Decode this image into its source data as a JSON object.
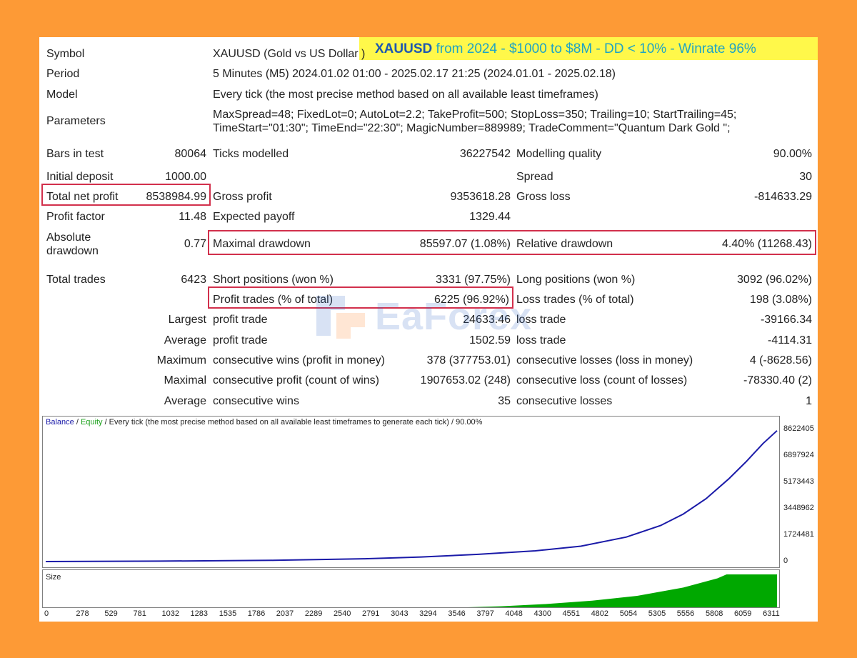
{
  "banner": {
    "symbol": "XAUUSD",
    "rest": " from 2024 - $1000 to $8M - DD < 10% - Winrate 96%"
  },
  "header": {
    "symbol_label": "Symbol",
    "symbol_value": "XAUUSD (Gold vs US Dollar )",
    "period_label": "Period",
    "period_value": "5 Minutes (M5) 2024.01.02 01:00 - 2025.02.17 21:25 (2024.01.01 - 2025.02.18)",
    "model_label": "Model",
    "model_value": "Every tick (the most precise method based on all available least timeframes)",
    "parameters_label": "Parameters",
    "parameters_line1": "MaxSpread=48; FixedLot=0; AutoLot=2.2; TakeProfit=500; StopLoss=350; Trailing=10; StartTrailing=45;",
    "parameters_line2": "TimeStart=\"01:30\"; TimeEnd=\"22:30\"; MagicNumber=889989; TradeComment=\"Quantum Dark Gold \";"
  },
  "stats": {
    "bars_label": "Bars in test",
    "bars_value": "80064",
    "ticks_label": "Ticks modelled",
    "ticks_value": "36227542",
    "quality_label": "Modelling quality",
    "quality_value": "90.00%",
    "deposit_label": "Initial deposit",
    "deposit_value": "1000.00",
    "spread_label": "Spread",
    "spread_value": "30",
    "net_profit_label": "Total net profit",
    "net_profit_value": "8538984.99",
    "gross_profit_label": "Gross profit",
    "gross_profit_value": "9353618.28",
    "gross_loss_label": "Gross loss",
    "gross_loss_value": "-814633.29",
    "profit_factor_label": "Profit factor",
    "profit_factor_value": "11.48",
    "expected_payoff_label": "Expected payoff",
    "expected_payoff_value": "1329.44",
    "abs_dd_label_1": "Absolute",
    "abs_dd_label_2": "drawdown",
    "abs_dd_value": "0.77",
    "max_dd_label": "Maximal drawdown",
    "max_dd_value": "85597.07 (1.08%)",
    "rel_dd_label": "Relative drawdown",
    "rel_dd_value": "4.40% (11268.43)",
    "total_trades_label": "Total trades",
    "total_trades_value": "6423",
    "short_label": "Short positions (won %)",
    "short_value": "3331 (97.75%)",
    "long_label": "Long positions (won %)",
    "long_value": "3092 (96.02%)",
    "profit_trades_label": "Profit trades (% of total)",
    "profit_trades_value": "6225 (96.92%)",
    "loss_trades_label": "Loss trades (% of total)",
    "loss_trades_value": "198 (3.08%)",
    "largest_label": "Largest",
    "largest_profit_label": "profit trade",
    "largest_profit_value": "24633.46",
    "largest_loss_label": "loss trade",
    "largest_loss_value": "-39166.34",
    "average_label": "Average",
    "average_profit_label": "profit trade",
    "average_profit_value": "1502.59",
    "average_loss_label": "loss trade",
    "average_loss_value": "-4114.31",
    "maximum_label": "Maximum",
    "max_cons_wins_label": "consecutive wins (profit in money)",
    "max_cons_wins_value": "378 (377753.01)",
    "max_cons_losses_label": "consecutive losses (loss in money)",
    "max_cons_losses_value": "4 (-8628.56)",
    "maximal_label": "Maximal",
    "maximal_cons_profit_label": "consecutive profit (count of wins)",
    "maximal_cons_profit_value": "1907653.02 (248)",
    "maximal_cons_loss_label": "consecutive loss (count of losses)",
    "maximal_cons_loss_value": "-78330.40 (2)",
    "avg2_label": "Average",
    "avg_cons_wins_label": "consecutive wins",
    "avg_cons_wins_value": "35",
    "avg_cons_losses_label": "consecutive losses",
    "avg_cons_losses_value": "1"
  },
  "watermark": {
    "text": "EaForex"
  },
  "chart_data": {
    "type": "line",
    "legend": {
      "balance": "Balance",
      "sep1": " / ",
      "equity": "Equity",
      "rest": " / Every tick (the most precise method based on all available least timeframes to generate each tick) / 90.00%"
    },
    "size_label": "Size",
    "y_ticks": [
      "8622405",
      "6897924",
      "5173443",
      "3448962",
      "1724481",
      "0"
    ],
    "y_values": [
      8622405,
      6897924,
      5173443,
      3448962,
      1724481,
      0
    ],
    "x_ticks": [
      "0",
      "278",
      "529",
      "781",
      "1032",
      "1283",
      "1535",
      "1786",
      "2037",
      "2289",
      "2540",
      "2791",
      "3043",
      "3294",
      "3546",
      "3797",
      "4048",
      "4300",
      "4551",
      "4802",
      "5054",
      "5305",
      "5556",
      "5808",
      "6059",
      "6311"
    ],
    "ylim": [
      0,
      8622405
    ],
    "xlim": [
      0,
      6423
    ],
    "series": [
      {
        "name": "Balance",
        "color": "#1a1aa8",
        "x": [
          0,
          1000,
          2000,
          2800,
          3300,
          3800,
          4300,
          4700,
          5100,
          5400,
          5600,
          5800,
          6000,
          6150,
          6300,
          6423
        ],
        "y": [
          1000,
          30000,
          80000,
          180000,
          300000,
          470000,
          700000,
          1000000,
          1600000,
          2350000,
          3100000,
          4100000,
          5400000,
          6500000,
          7700000,
          8539985
        ]
      }
    ],
    "size_series": {
      "color": "#00A800",
      "x": [
        0,
        3700,
        4000,
        4400,
        4800,
        5200,
        5600,
        5900,
        5980,
        6423
      ],
      "level": [
        0,
        0,
        0.03,
        0.1,
        0.2,
        0.35,
        0.6,
        0.88,
        1.0,
        1.0
      ]
    }
  }
}
